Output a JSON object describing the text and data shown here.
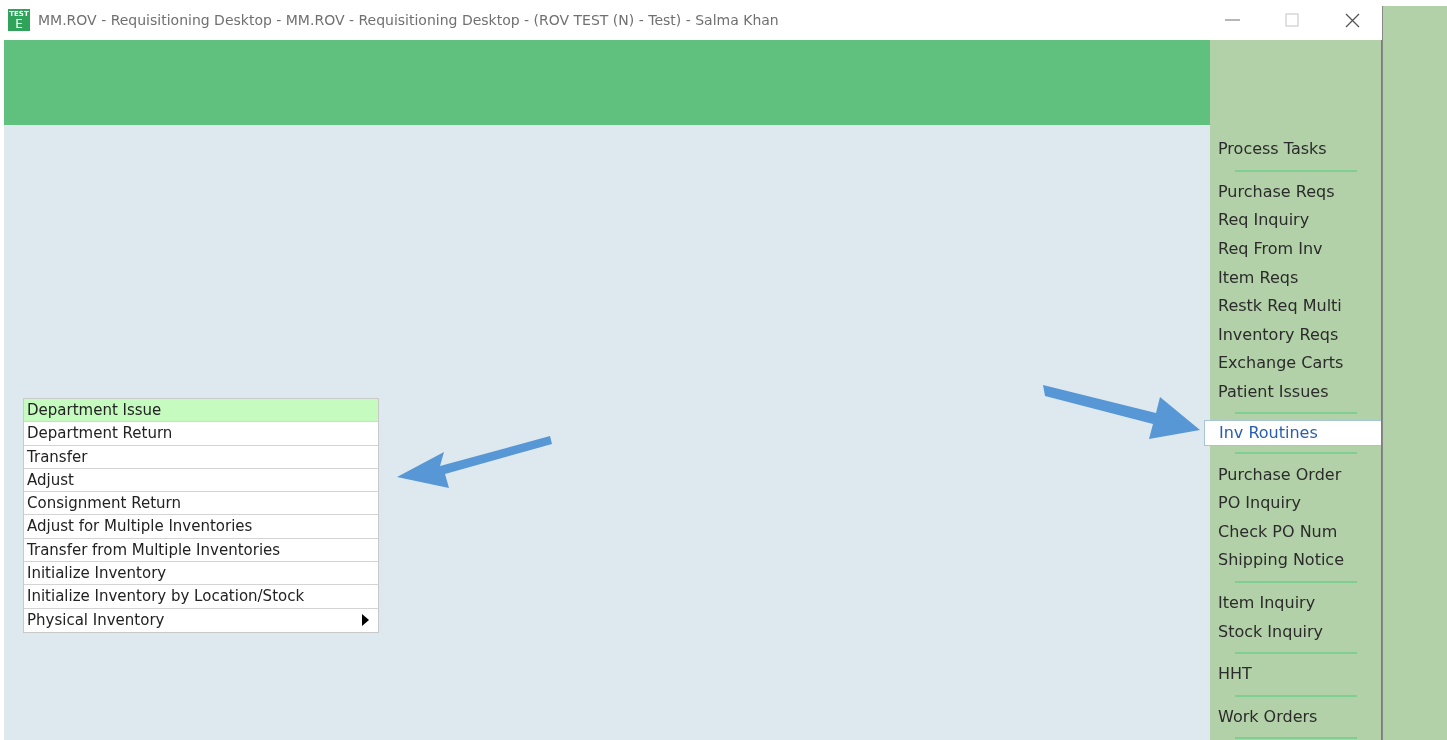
{
  "window": {
    "title": "MM.ROV - Requisitioning Desktop - MM.ROV - Requisitioning Desktop - (ROV TEST (N) - Test) - Salma Khan",
    "app_icon": {
      "badge": "TEST",
      "letter": "E"
    }
  },
  "menu": {
    "items": [
      {
        "label": "Department Issue",
        "selected": true,
        "kind": "action"
      },
      {
        "label": "Department Return",
        "selected": false,
        "kind": "action"
      },
      {
        "label": "Transfer",
        "selected": false,
        "kind": "action"
      },
      {
        "label": "Adjust",
        "selected": false,
        "kind": "action"
      },
      {
        "label": "Consignment Return",
        "selected": false,
        "kind": "action"
      },
      {
        "label": "Adjust for Multiple Inventories",
        "selected": false,
        "kind": "action"
      },
      {
        "label": "Transfer from Multiple Inventories",
        "selected": false,
        "kind": "action"
      },
      {
        "label": "Initialize Inventory",
        "selected": false,
        "kind": "action"
      },
      {
        "label": "Initialize Inventory by Location/Stock",
        "selected": false,
        "kind": "action"
      },
      {
        "label": "Physical Inventory",
        "selected": false,
        "kind": "submenu"
      }
    ]
  },
  "sidebar": {
    "groups": [
      {
        "items": [
          {
            "label": "Process Tasks",
            "selected": false
          }
        ]
      },
      {
        "items": [
          {
            "label": "Purchase Reqs",
            "selected": false
          },
          {
            "label": "Req Inquiry",
            "selected": false
          },
          {
            "label": "Req From Inv",
            "selected": false
          },
          {
            "label": "Item Reqs",
            "selected": false
          },
          {
            "label": "Restk Req Multi",
            "selected": false
          },
          {
            "label": "Inventory Reqs",
            "selected": false
          },
          {
            "label": "Exchange Carts",
            "selected": false
          },
          {
            "label": "Patient Issues",
            "selected": false
          }
        ]
      },
      {
        "items": [
          {
            "label": "Inv Routines",
            "selected": true
          }
        ]
      },
      {
        "items": [
          {
            "label": "Purchase Order",
            "selected": false
          },
          {
            "label": "PO Inquiry",
            "selected": false
          },
          {
            "label": "Check PO Num",
            "selected": false
          },
          {
            "label": "Shipping Notice",
            "selected": false
          }
        ]
      },
      {
        "items": [
          {
            "label": "Item Inquiry",
            "selected": false
          },
          {
            "label": "Stock Inquiry",
            "selected": false
          }
        ]
      },
      {
        "items": [
          {
            "label": "HHT",
            "selected": false
          }
        ]
      },
      {
        "items": [
          {
            "label": "Work Orders",
            "selected": false
          }
        ]
      }
    ]
  }
}
